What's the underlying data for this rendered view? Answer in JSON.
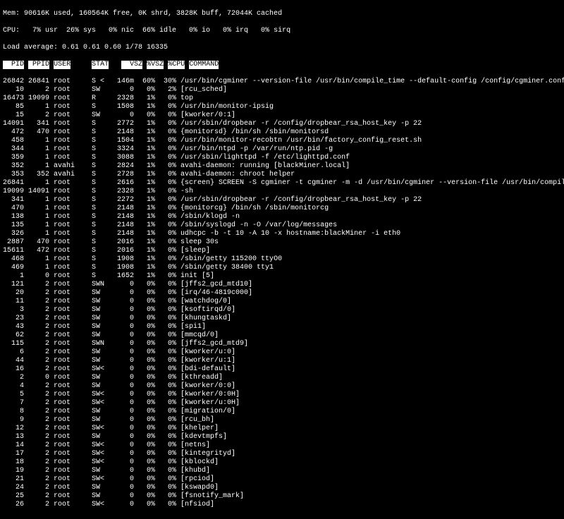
{
  "mem_line": "Mem: 90616K used, 160564K free, 0K shrd, 3828K buff, 72044K cached",
  "cpu_line": "CPU:   7% usr  26% sys   0% nic  66% idle   0% io   0% irq   0% sirq",
  "load_line": "Load average: 0.61 0.61 0.60 1/78 16335",
  "header": {
    "pid": "  PID",
    "ppid": " PPID",
    "user": "USER",
    "stat": "STAT",
    "vsz": "  VSZ",
    "pvsz": "%VSZ",
    "pcpu": "%CPU",
    "command": "COMMAND"
  },
  "rows": [
    {
      "pid": "26842",
      "ppid": "26841",
      "user": "root",
      "stat": "S <",
      "vsz": "146m",
      "pvsz": "60%",
      "pcpu": "30%",
      "cmd": "/usr/bin/cgminer --version-file /usr/bin/compile_time --default-config /config/cgminer.conf -T"
    },
    {
      "pid": "10",
      "ppid": "2",
      "user": "root",
      "stat": "SW",
      "vsz": "0",
      "pvsz": "0%",
      "pcpu": "2%",
      "cmd": "[rcu_sched]"
    },
    {
      "pid": "16473",
      "ppid": "19099",
      "user": "root",
      "stat": "R",
      "vsz": "2328",
      "pvsz": "1%",
      "pcpu": "0%",
      "cmd": "top"
    },
    {
      "pid": "85",
      "ppid": "1",
      "user": "root",
      "stat": "S",
      "vsz": "1508",
      "pvsz": "1%",
      "pcpu": "0%",
      "cmd": "/usr/bin/monitor-ipsig"
    },
    {
      "pid": "15",
      "ppid": "2",
      "user": "root",
      "stat": "SW",
      "vsz": "0",
      "pvsz": "0%",
      "pcpu": "0%",
      "cmd": "[kworker/0:1]"
    },
    {
      "pid": "14091",
      "ppid": "341",
      "user": "root",
      "stat": "S",
      "vsz": "2772",
      "pvsz": "1%",
      "pcpu": "0%",
      "cmd": "/usr/sbin/dropbear -r /config/dropbear_rsa_host_key -p 22"
    },
    {
      "pid": "472",
      "ppid": "470",
      "user": "root",
      "stat": "S",
      "vsz": "2148",
      "pvsz": "1%",
      "pcpu": "0%",
      "cmd": "{monitorsd} /bin/sh /sbin/monitorsd"
    },
    {
      "pid": "458",
      "ppid": "1",
      "user": "root",
      "stat": "S",
      "vsz": "1504",
      "pvsz": "1%",
      "pcpu": "0%",
      "cmd": "/usr/bin/monitor-recobtn /usr/bin/factory_config_reset.sh"
    },
    {
      "pid": "344",
      "ppid": "1",
      "user": "root",
      "stat": "S",
      "vsz": "3324",
      "pvsz": "1%",
      "pcpu": "0%",
      "cmd": "/usr/bin/ntpd -p /var/run/ntp.pid -g"
    },
    {
      "pid": "359",
      "ppid": "1",
      "user": "root",
      "stat": "S",
      "vsz": "3088",
      "pvsz": "1%",
      "pcpu": "0%",
      "cmd": "/usr/sbin/lighttpd -f /etc/lighttpd.conf"
    },
    {
      "pid": "352",
      "ppid": "1",
      "user": "avahi",
      "stat": "S",
      "vsz": "2824",
      "pvsz": "1%",
      "pcpu": "0%",
      "cmd": "avahi-daemon: running [blackMiner.local]"
    },
    {
      "pid": "353",
      "ppid": "352",
      "user": "avahi",
      "stat": "S",
      "vsz": "2728",
      "pvsz": "1%",
      "pcpu": "0%",
      "cmd": "avahi-daemon: chroot helper"
    },
    {
      "pid": "26841",
      "ppid": "1",
      "user": "root",
      "stat": "S",
      "vsz": "2616",
      "pvsz": "1%",
      "pcpu": "0%",
      "cmd": "{screen} SCREEN -S cgminer -t cgminer -m -d /usr/bin/cgminer --version-file /usr/bin/compile_time --default-config /config/cgminer.c"
    },
    {
      "pid": "19099",
      "ppid": "14091",
      "user": "root",
      "stat": "S",
      "vsz": "2328",
      "pvsz": "1%",
      "pcpu": "0%",
      "cmd": "-sh"
    },
    {
      "pid": "341",
      "ppid": "1",
      "user": "root",
      "stat": "S",
      "vsz": "2272",
      "pvsz": "1%",
      "pcpu": "0%",
      "cmd": "/usr/sbin/dropbear -r /config/dropbear_rsa_host_key -p 22"
    },
    {
      "pid": "470",
      "ppid": "1",
      "user": "root",
      "stat": "S",
      "vsz": "2148",
      "pvsz": "1%",
      "pcpu": "0%",
      "cmd": "{monitorcg} /bin/sh /sbin/monitorcg"
    },
    {
      "pid": "138",
      "ppid": "1",
      "user": "root",
      "stat": "S",
      "vsz": "2148",
      "pvsz": "1%",
      "pcpu": "0%",
      "cmd": "/sbin/klogd -n"
    },
    {
      "pid": "135",
      "ppid": "1",
      "user": "root",
      "stat": "S",
      "vsz": "2148",
      "pvsz": "1%",
      "pcpu": "0%",
      "cmd": "/sbin/syslogd -n -O /var/log/messages"
    },
    {
      "pid": "326",
      "ppid": "1",
      "user": "root",
      "stat": "S",
      "vsz": "2148",
      "pvsz": "1%",
      "pcpu": "0%",
      "cmd": "udhcpc -b -t 10 -A 10 -x hostname:blackMiner -i eth0"
    },
    {
      "pid": "2887",
      "ppid": "470",
      "user": "root",
      "stat": "S",
      "vsz": "2016",
      "pvsz": "1%",
      "pcpu": "0%",
      "cmd": "sleep 30s"
    },
    {
      "pid": "15611",
      "ppid": "472",
      "user": "root",
      "stat": "S",
      "vsz": "2016",
      "pvsz": "1%",
      "pcpu": "0%",
      "cmd": "[sleep]"
    },
    {
      "pid": "468",
      "ppid": "1",
      "user": "root",
      "stat": "S",
      "vsz": "1908",
      "pvsz": "1%",
      "pcpu": "0%",
      "cmd": "/sbin/getty 115200 ttyO0"
    },
    {
      "pid": "469",
      "ppid": "1",
      "user": "root",
      "stat": "S",
      "vsz": "1908",
      "pvsz": "1%",
      "pcpu": "0%",
      "cmd": "/sbin/getty 38400 tty1"
    },
    {
      "pid": "1",
      "ppid": "0",
      "user": "root",
      "stat": "S",
      "vsz": "1652",
      "pvsz": "1%",
      "pcpu": "0%",
      "cmd": "init [5]"
    },
    {
      "pid": "121",
      "ppid": "2",
      "user": "root",
      "stat": "SWN",
      "vsz": "0",
      "pvsz": "0%",
      "pcpu": "0%",
      "cmd": "[jffs2_gcd_mtd10]"
    },
    {
      "pid": "20",
      "ppid": "2",
      "user": "root",
      "stat": "SW",
      "vsz": "0",
      "pvsz": "0%",
      "pcpu": "0%",
      "cmd": "[irq/46-4819c000]"
    },
    {
      "pid": "11",
      "ppid": "2",
      "user": "root",
      "stat": "SW",
      "vsz": "0",
      "pvsz": "0%",
      "pcpu": "0%",
      "cmd": "[watchdog/0]"
    },
    {
      "pid": "3",
      "ppid": "2",
      "user": "root",
      "stat": "SW",
      "vsz": "0",
      "pvsz": "0%",
      "pcpu": "0%",
      "cmd": "[ksoftirqd/0]"
    },
    {
      "pid": "23",
      "ppid": "2",
      "user": "root",
      "stat": "SW",
      "vsz": "0",
      "pvsz": "0%",
      "pcpu": "0%",
      "cmd": "[khungtaskd]"
    },
    {
      "pid": "43",
      "ppid": "2",
      "user": "root",
      "stat": "SW",
      "vsz": "0",
      "pvsz": "0%",
      "pcpu": "0%",
      "cmd": "[spi1]"
    },
    {
      "pid": "62",
      "ppid": "2",
      "user": "root",
      "stat": "SW",
      "vsz": "0",
      "pvsz": "0%",
      "pcpu": "0%",
      "cmd": "[mmcqd/0]"
    },
    {
      "pid": "115",
      "ppid": "2",
      "user": "root",
      "stat": "SWN",
      "vsz": "0",
      "pvsz": "0%",
      "pcpu": "0%",
      "cmd": "[jffs2_gcd_mtd9]"
    },
    {
      "pid": "6",
      "ppid": "2",
      "user": "root",
      "stat": "SW",
      "vsz": "0",
      "pvsz": "0%",
      "pcpu": "0%",
      "cmd": "[kworker/u:0]"
    },
    {
      "pid": "44",
      "ppid": "2",
      "user": "root",
      "stat": "SW",
      "vsz": "0",
      "pvsz": "0%",
      "pcpu": "0%",
      "cmd": "[kworker/u:1]"
    },
    {
      "pid": "16",
      "ppid": "2",
      "user": "root",
      "stat": "SW<",
      "vsz": "0",
      "pvsz": "0%",
      "pcpu": "0%",
      "cmd": "[bdi-default]"
    },
    {
      "pid": "2",
      "ppid": "0",
      "user": "root",
      "stat": "SW",
      "vsz": "0",
      "pvsz": "0%",
      "pcpu": "0%",
      "cmd": "[kthreadd]"
    },
    {
      "pid": "4",
      "ppid": "2",
      "user": "root",
      "stat": "SW",
      "vsz": "0",
      "pvsz": "0%",
      "pcpu": "0%",
      "cmd": "[kworker/0:0]"
    },
    {
      "pid": "5",
      "ppid": "2",
      "user": "root",
      "stat": "SW<",
      "vsz": "0",
      "pvsz": "0%",
      "pcpu": "0%",
      "cmd": "[kworker/0:0H]"
    },
    {
      "pid": "7",
      "ppid": "2",
      "user": "root",
      "stat": "SW<",
      "vsz": "0",
      "pvsz": "0%",
      "pcpu": "0%",
      "cmd": "[kworker/u:0H]"
    },
    {
      "pid": "8",
      "ppid": "2",
      "user": "root",
      "stat": "SW",
      "vsz": "0",
      "pvsz": "0%",
      "pcpu": "0%",
      "cmd": "[migration/0]"
    },
    {
      "pid": "9",
      "ppid": "2",
      "user": "root",
      "stat": "SW",
      "vsz": "0",
      "pvsz": "0%",
      "pcpu": "0%",
      "cmd": "[rcu_bh]"
    },
    {
      "pid": "12",
      "ppid": "2",
      "user": "root",
      "stat": "SW<",
      "vsz": "0",
      "pvsz": "0%",
      "pcpu": "0%",
      "cmd": "[khelper]"
    },
    {
      "pid": "13",
      "ppid": "2",
      "user": "root",
      "stat": "SW",
      "vsz": "0",
      "pvsz": "0%",
      "pcpu": "0%",
      "cmd": "[kdevtmpfs]"
    },
    {
      "pid": "14",
      "ppid": "2",
      "user": "root",
      "stat": "SW<",
      "vsz": "0",
      "pvsz": "0%",
      "pcpu": "0%",
      "cmd": "[netns]"
    },
    {
      "pid": "17",
      "ppid": "2",
      "user": "root",
      "stat": "SW<",
      "vsz": "0",
      "pvsz": "0%",
      "pcpu": "0%",
      "cmd": "[kintegrityd]"
    },
    {
      "pid": "18",
      "ppid": "2",
      "user": "root",
      "stat": "SW<",
      "vsz": "0",
      "pvsz": "0%",
      "pcpu": "0%",
      "cmd": "[kblockd]"
    },
    {
      "pid": "19",
      "ppid": "2",
      "user": "root",
      "stat": "SW",
      "vsz": "0",
      "pvsz": "0%",
      "pcpu": "0%",
      "cmd": "[khubd]"
    },
    {
      "pid": "21",
      "ppid": "2",
      "user": "root",
      "stat": "SW<",
      "vsz": "0",
      "pvsz": "0%",
      "pcpu": "0%",
      "cmd": "[rpciod]"
    },
    {
      "pid": "24",
      "ppid": "2",
      "user": "root",
      "stat": "SW",
      "vsz": "0",
      "pvsz": "0%",
      "pcpu": "0%",
      "cmd": "[kswapd0]"
    },
    {
      "pid": "25",
      "ppid": "2",
      "user": "root",
      "stat": "SW",
      "vsz": "0",
      "pvsz": "0%",
      "pcpu": "0%",
      "cmd": "[fsnotify_mark]"
    },
    {
      "pid": "26",
      "ppid": "2",
      "user": "root",
      "stat": "SW<",
      "vsz": "0",
      "pvsz": "0%",
      "pcpu": "0%",
      "cmd": "[nfsiod]"
    }
  ]
}
